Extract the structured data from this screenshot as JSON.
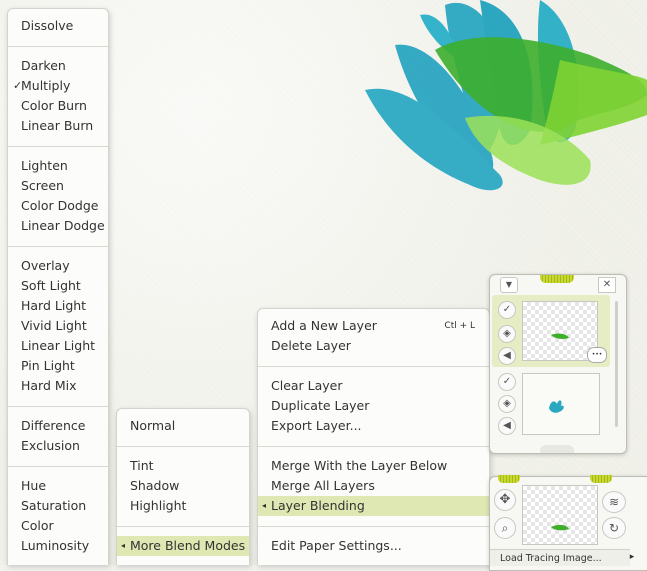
{
  "blend_menu": {
    "items": [
      {
        "label": "Dissolve",
        "checked": false
      },
      {
        "label": "Darken",
        "checked": false
      },
      {
        "label": "Multiply",
        "checked": true
      },
      {
        "label": "Color Burn",
        "checked": false
      },
      {
        "label": "Linear Burn",
        "checked": false
      },
      {
        "label": "Lighten",
        "checked": false
      },
      {
        "label": "Screen",
        "checked": false
      },
      {
        "label": "Color Dodge",
        "checked": false
      },
      {
        "label": "Linear Dodge",
        "checked": false
      },
      {
        "label": "Overlay",
        "checked": false
      },
      {
        "label": "Soft Light",
        "checked": false
      },
      {
        "label": "Hard Light",
        "checked": false
      },
      {
        "label": "Vivid Light",
        "checked": false
      },
      {
        "label": "Linear Light",
        "checked": false
      },
      {
        "label": "Pin Light",
        "checked": false
      },
      {
        "label": "Hard Mix",
        "checked": false
      },
      {
        "label": "Difference",
        "checked": false
      },
      {
        "label": "Exclusion",
        "checked": false
      },
      {
        "label": "Hue",
        "checked": false
      },
      {
        "label": "Saturation",
        "checked": false
      },
      {
        "label": "Color",
        "checked": false
      },
      {
        "label": "Luminosity",
        "checked": false
      }
    ],
    "check_mark": "✓"
  },
  "more_modes_menu": {
    "items": [
      {
        "label": "Normal"
      },
      {
        "label": "Tint"
      },
      {
        "label": "Shadow"
      },
      {
        "label": "Highlight"
      },
      {
        "label": "More Blend Modes",
        "selected": true
      }
    ]
  },
  "layer_menu": {
    "items": [
      {
        "label": "Add a New Layer",
        "shortcut": "Ctl + L"
      },
      {
        "label": "Delete Layer"
      },
      {
        "label": "Clear Layer"
      },
      {
        "label": "Duplicate Layer"
      },
      {
        "label": "Export Layer..."
      },
      {
        "label": "Merge With the Layer Below"
      },
      {
        "label": "Merge All Layers"
      },
      {
        "label": "Layer Blending",
        "selected": true
      },
      {
        "label": "Edit Paper Settings..."
      }
    ],
    "submenu_arrow": "◂"
  },
  "layers_panel": {
    "close_label": "✕",
    "more_label": "•••"
  },
  "tracing_panel": {
    "load_label": "Load Tracing Image...",
    "next_arrow": "▸"
  },
  "colors": {
    "highlight": "#dfe8b2",
    "teal": "#2aa8c0",
    "green": "#3fae2a",
    "lime": "#8fd43c"
  }
}
